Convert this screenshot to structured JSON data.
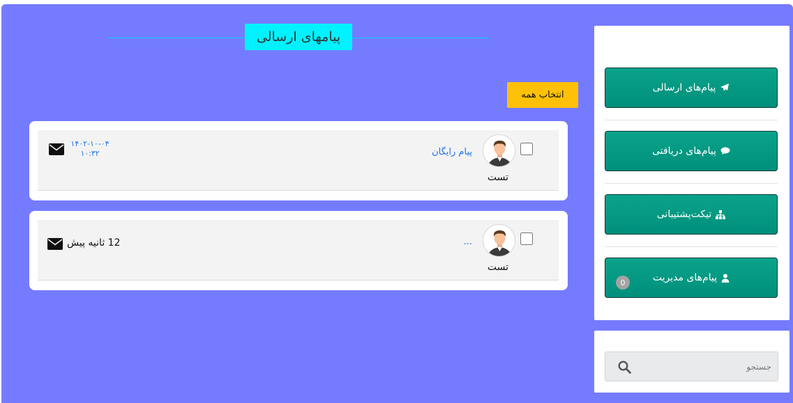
{
  "header": {
    "title": "پیامهای ارسالی"
  },
  "toolbar": {
    "select_all_label": "انتخاب همه"
  },
  "messages": [
    {
      "user": "تست",
      "subject": "پیام رایگان",
      "date": "۱۴۰۲-۱۰-۰۴",
      "time": "۱۰:۳۲"
    },
    {
      "user": "تست",
      "subject": "...",
      "relative_time": "12 ثانیه پیش"
    }
  ],
  "sidebar": {
    "items": [
      {
        "label": "پیام‌های ارسالی",
        "icon": "paper-plane-icon"
      },
      {
        "label": "پیام‌های دریافتی",
        "icon": "chat-bubble-icon"
      },
      {
        "label": "تیکت‌پشتیبانی",
        "icon": "sitemap-icon"
      },
      {
        "label": "پیام‌های مدیریت",
        "icon": "user-icon",
        "badge": "0"
      }
    ]
  },
  "search": {
    "placeholder": "جستجو"
  },
  "colors": {
    "background": "#757bff",
    "sidebar_button": "#009a85",
    "title_bg": "#00f2ff",
    "select_all_bg": "#ffc107",
    "link": "#1a73e8"
  }
}
